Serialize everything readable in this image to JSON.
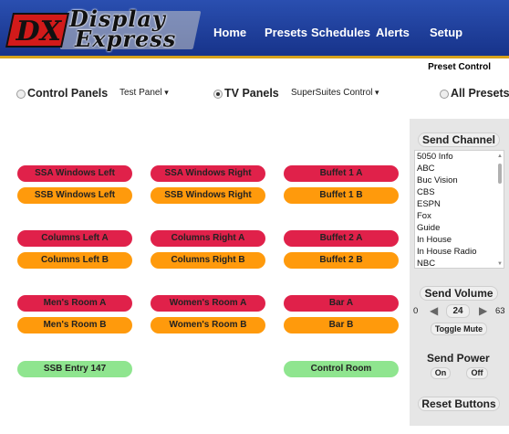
{
  "logo": {
    "mark": "DX",
    "line1": "Display",
    "line2": "Express"
  },
  "nav": {
    "home": "Home",
    "presets": "Presets",
    "schedules": "Schedules",
    "alerts": "Alerts",
    "setup": "Setup"
  },
  "page_title": "Preset Control",
  "selectors": {
    "control_panels": {
      "label": "Control Panels",
      "value": "Test Panel",
      "selected": false
    },
    "tv_panels": {
      "label": "TV Panels",
      "value": "SuperSuites Control",
      "selected": true
    },
    "all_presets": {
      "label": "All Presets",
      "selected": false
    }
  },
  "buttons": {
    "ssa_windows_left": "SSA Windows Left",
    "ssa_windows_right": "SSA Windows Right",
    "buffet_1a": "Buffet 1 A",
    "ssb_windows_left": "SSB Windows Left",
    "ssb_windows_right": "SSB Windows Right",
    "buffet_1b": "Buffet 1 B",
    "columns_left_a": "Columns Left A",
    "columns_right_a": "Columns Right A",
    "buffet_2a": "Buffet 2 A",
    "columns_left_b": "Columns Left B",
    "columns_right_b": "Columns Right B",
    "buffet_2b": "Buffet 2 B",
    "mens_room_a": "Men's Room A",
    "womens_room_a": "Women's Room A",
    "bar_a": "Bar A",
    "mens_room_b": "Men's Room B",
    "womens_room_b": "Women's Room B",
    "bar_b": "Bar B",
    "ssb_entry_147": "SSB Entry 147",
    "control_room": "Control Room"
  },
  "side": {
    "send_channel": "Send Channel",
    "channels": [
      "5050 Info",
      "ABC",
      "Buc Vision",
      "CBS",
      "ESPN",
      "Fox",
      "Guide",
      "In House",
      "In House Radio",
      "NBC"
    ],
    "send_volume": "Send Volume",
    "volume_min": "0",
    "volume_value": "24",
    "volume_max": "63",
    "toggle_mute": "Toggle Mute",
    "send_power": "Send Power",
    "power_on": "On",
    "power_off": "Off",
    "reset_buttons": "Reset Buttons"
  },
  "colors": {
    "header_blue": "#1e3f99",
    "header_stripe": "#d7a21b",
    "red": "#e0214a",
    "orange": "#ff9a0c",
    "green": "#8fe58f"
  }
}
